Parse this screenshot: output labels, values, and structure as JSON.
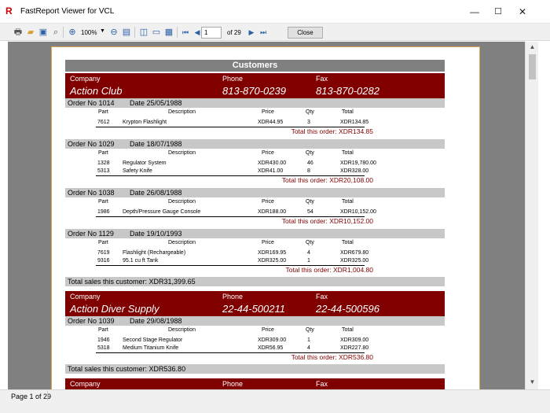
{
  "window": {
    "title": "FastReport Viewer for VCL",
    "min_glyph": "—",
    "max_glyph": "☐",
    "close_glyph": "✕"
  },
  "toolbar": {
    "zoom": "100%",
    "page_input": "1",
    "page_of": "of 29",
    "close_label": "Close",
    "icons": [
      "print-icon",
      "open-icon",
      "save-icon",
      "find-icon",
      "zoom-in-icon",
      "zoom-out-icon",
      "page-width-icon",
      "one-page-icon",
      "outline-icon",
      "thumbnails-icon",
      "first-page-icon",
      "prev-page-icon",
      "next-page-icon",
      "last-page-icon"
    ]
  },
  "status": {
    "page": "Page 1 of 29"
  },
  "report": {
    "title": "Customers",
    "col_headers": {
      "part": "Part",
      "desc": "Description",
      "price": "Price",
      "qty": "Qty",
      "total": "Total"
    },
    "labels": {
      "company": "Company",
      "phone": "Phone",
      "fax": "Fax"
    },
    "customers": [
      {
        "company": "Action Club",
        "phone": "813-870-0239",
        "fax": "813-870-0282",
        "orders": [
          {
            "no": "Order No 1014",
            "date": "Date 25/05/1988",
            "items": [
              {
                "part": "7612",
                "desc": "Krypton Flashlight",
                "price": "XDR44.95",
                "qty": "3",
                "total": "XDR134.85"
              }
            ],
            "total": "Total this order: XDR134.85"
          },
          {
            "no": "Order No 1029",
            "date": "Date 18/07/1988",
            "items": [
              {
                "part": "1328",
                "desc": "Regulator System",
                "price": "XDR430.00",
                "qty": "46",
                "total": "XDR19,780.00"
              },
              {
                "part": "5313",
                "desc": "Safety Knife",
                "price": "XDR41.00",
                "qty": "8",
                "total": "XDR328.00"
              }
            ],
            "total": "Total this order: XDR20,108.00"
          },
          {
            "no": "Order No 1038",
            "date": "Date 26/08/1988",
            "items": [
              {
                "part": "1986",
                "desc": "Depth/Pressure Gauge Console",
                "price": "XDR188.00",
                "qty": "54",
                "total": "XDR10,152.00"
              }
            ],
            "total": "Total this order: XDR10,152.00"
          },
          {
            "no": "Order No 1129",
            "date": "Date 19/10/1993",
            "items": [
              {
                "part": "7619",
                "desc": "Flashlight (Rechargeable)",
                "price": "XDR169.95",
                "qty": "4",
                "total": "XDR679.80"
              },
              {
                "part": "9316",
                "desc": "95.1 cu ft Tank",
                "price": "XDR325.00",
                "qty": "1",
                "total": "XDR325.00"
              }
            ],
            "total": "Total this order: XDR1,004.80"
          }
        ],
        "sales_total": "Total sales this customer: XDR31,399.65"
      },
      {
        "company": "Action Diver Supply",
        "phone": "22-44-500211",
        "fax": "22-44-500596",
        "orders": [
          {
            "no": "Order No 1039",
            "date": "Date 29/08/1988",
            "items": [
              {
                "part": "1946",
                "desc": "Second Stage Regulator",
                "price": "XDR309.00",
                "qty": "1",
                "total": "XDR309.00"
              },
              {
                "part": "5318",
                "desc": "Medium Titanium Knife",
                "price": "XDR56.95",
                "qty": "4",
                "total": "XDR227.80"
              }
            ],
            "total": "Total this order: XDR536.80"
          }
        ],
        "sales_total": "Total sales this customer: XDR536.80"
      }
    ]
  }
}
